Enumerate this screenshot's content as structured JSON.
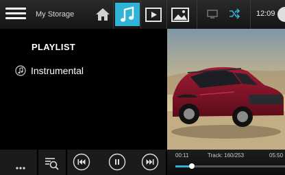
{
  "header": {
    "storage_label": "My Storage",
    "clock": "12:09"
  },
  "playlist": {
    "title": "PLAYLIST",
    "items": [
      {
        "label": "Instrumental",
        "icon": "music-note-icon"
      }
    ]
  },
  "playback": {
    "elapsed": "00:11",
    "track": "Track: 160/253",
    "total": "05:50",
    "progress": 0.03
  },
  "colors": {
    "accent": "#2fb3d6"
  }
}
